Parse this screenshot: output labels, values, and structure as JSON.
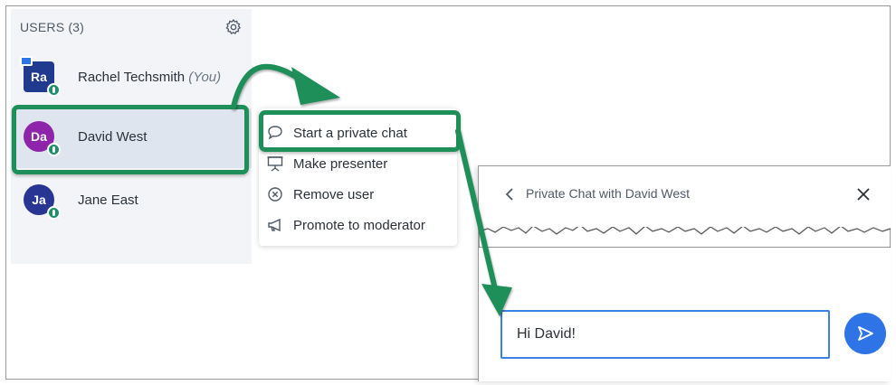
{
  "users": {
    "header": "USERS (3)",
    "list": [
      {
        "initials": "Ra",
        "name": "Rachel Techsmith",
        "suffix": "(You)",
        "color": "#1f3a8f"
      },
      {
        "initials": "Da",
        "name": "David West",
        "color": "#8e24aa"
      },
      {
        "initials": "Ja",
        "name": "Jane East",
        "color": "#283593"
      }
    ]
  },
  "menu": {
    "items": [
      {
        "label": "Start a private chat",
        "icon": "speech-bubble-icon"
      },
      {
        "label": "Make presenter",
        "icon": "presentation-screen-icon"
      },
      {
        "label": "Remove user",
        "icon": "circle-x-icon"
      },
      {
        "label": "Promote to moderator",
        "icon": "megaphone-icon"
      }
    ]
  },
  "chat": {
    "title": "Private Chat with David West",
    "input_value": "Hi David!"
  },
  "colors": {
    "accent": "#2f74e6",
    "highlight": "#1f8f5a",
    "status": "#1f8f6a"
  }
}
